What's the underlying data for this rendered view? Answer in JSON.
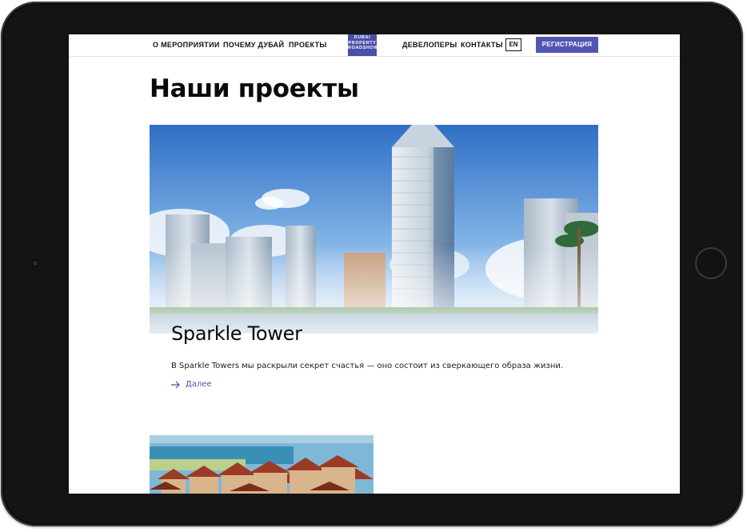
{
  "nav": {
    "items_left": [
      "О МЕРОПРИЯТИИ",
      "ПОЧЕМУ ДУБАЙ",
      "ПРОЕКТЫ"
    ],
    "items_right": [
      "ДЕВЕЛОПЕРЫ",
      "КОНТАКТЫ"
    ],
    "logo_lines": [
      "DUBAI",
      "PROPERTY",
      "ROADSHOW"
    ],
    "lang": "EN",
    "register": "РЕГИСТРАЦИЯ"
  },
  "page": {
    "title": "Наши проекты"
  },
  "projects": [
    {
      "title": "Sparkle Tower",
      "description": "В Sparkle Towers мы раскрыли секрет счастья — оно состоит из сверкающего образа жизни.",
      "more": "Далее"
    }
  ],
  "colors": {
    "accent": "#5156b3",
    "device_frame": "#141414",
    "text": "#0a0a0a"
  },
  "icons": [
    "arrow-right-icon",
    "camera-icon",
    "home-button-icon"
  ]
}
